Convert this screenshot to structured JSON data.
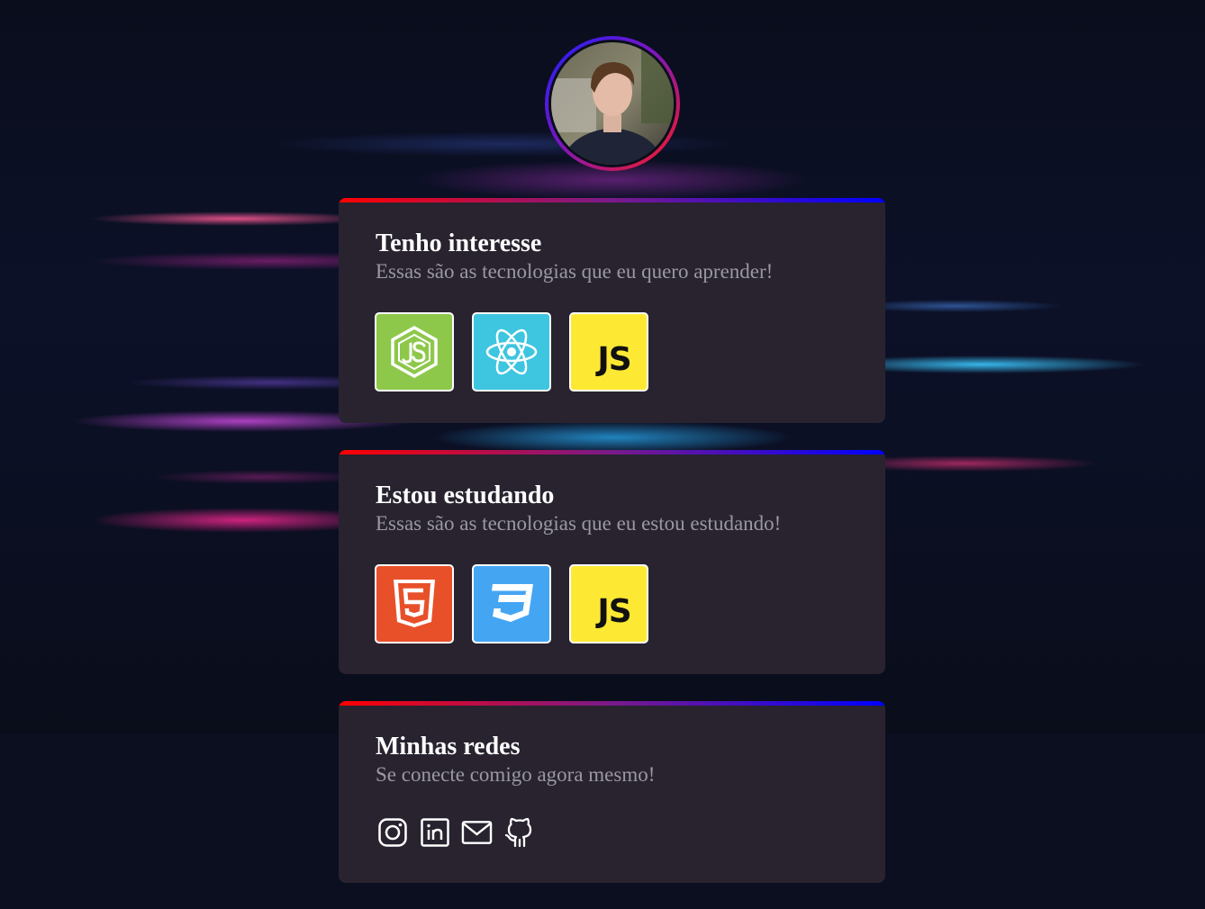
{
  "profile": {
    "avatar_icon": "profile-photo"
  },
  "sections": [
    {
      "title": "Tenho interesse",
      "subtitle": "Essas são as tecnologias que eu quero aprender!",
      "techs": [
        {
          "name": "Node.js",
          "icon": "nodejs-icon",
          "color": "#8dc84b"
        },
        {
          "name": "React",
          "icon": "react-icon",
          "color": "#3ec5e0"
        },
        {
          "name": "JavaScript",
          "icon": "javascript-icon",
          "label": "JS",
          "color": "#fde934"
        }
      ]
    },
    {
      "title": "Estou estudando",
      "subtitle": "Essas são as tecnologias que eu estou estudando!",
      "techs": [
        {
          "name": "HTML5",
          "icon": "html5-icon",
          "color": "#e8502a"
        },
        {
          "name": "CSS3",
          "icon": "css3-icon",
          "color": "#44a5f3"
        },
        {
          "name": "JavaScript",
          "icon": "javascript-icon",
          "label": "JS",
          "color": "#fde934"
        }
      ]
    },
    {
      "title": "Minhas redes",
      "subtitle": "Se conecte comigo agora mesmo!",
      "socials": [
        {
          "name": "Instagram",
          "icon": "instagram-icon"
        },
        {
          "name": "LinkedIn",
          "icon": "linkedin-icon"
        },
        {
          "name": "Email",
          "icon": "email-icon"
        },
        {
          "name": "GitHub",
          "icon": "github-icon"
        }
      ]
    }
  ],
  "colors": {
    "card_background": "#28232f",
    "accent_gradient_start": "#ff0000",
    "accent_gradient_end": "#0000ff",
    "title": "#ffffff",
    "subtitle": "#9a98a2"
  }
}
